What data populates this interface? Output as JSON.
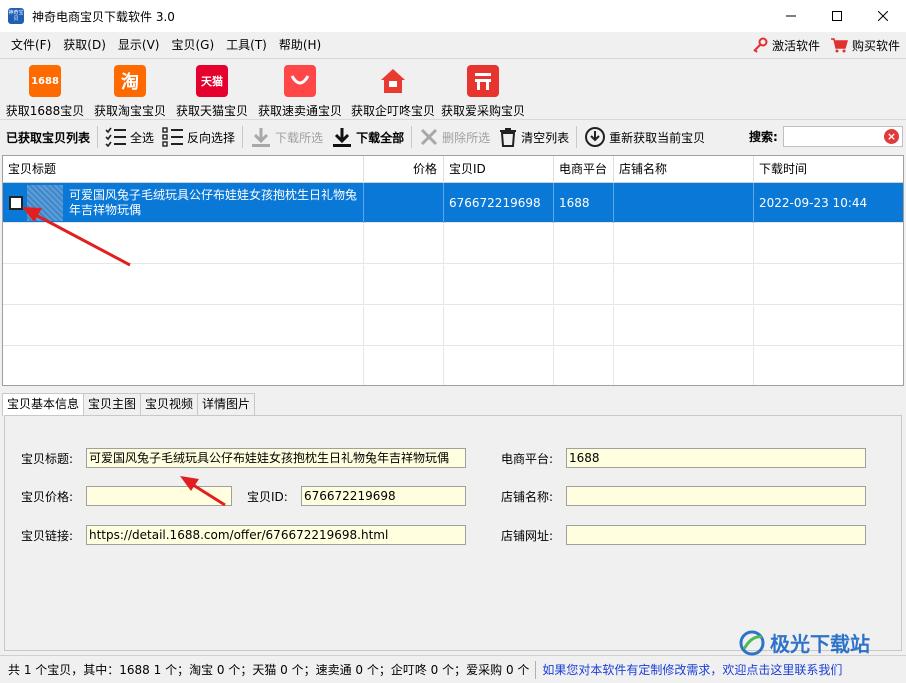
{
  "window": {
    "title": "神奇电商宝贝下载软件 3.0",
    "icon_text": "神奇宝贝",
    "controls": [
      "minimize-icon",
      "maximize-icon",
      "close-icon"
    ]
  },
  "menu": {
    "items": [
      "文件(F)",
      "获取(D)",
      "显示(V)",
      "宝贝(G)",
      "工具(T)",
      "帮助(H)"
    ],
    "activate": "激活软件",
    "buy": "购买软件"
  },
  "big_toolbar": [
    {
      "label": "获取1688宝贝",
      "icon": "1688",
      "color": "#ff6a00"
    },
    {
      "label": "获取淘宝宝贝",
      "icon": "淘",
      "color": "#ff6a00"
    },
    {
      "label": "获取天猫宝贝",
      "icon": "天猫",
      "color": "#e5002d"
    },
    {
      "label": "获取速卖通宝贝",
      "icon": "aliexpress-icon",
      "color": "#ff4747"
    },
    {
      "label": "获取企叮咚宝贝",
      "icon": "house-icon",
      "color": "#e83a2e"
    },
    {
      "label": "获取爱采购宝贝",
      "icon": "aicaigou-icon",
      "color": "#e8342e"
    }
  ],
  "toolbar2": {
    "list_label": "已获取宝贝列表",
    "select_all": "全选",
    "invert": "反向选择",
    "download_selected": "下载所选",
    "download_all": "下载全部",
    "delete_selected": "删除所选",
    "clear_list": "清空列表",
    "refetch": "重新获取当前宝贝",
    "search_label": "搜索:",
    "search_value": ""
  },
  "grid": {
    "columns": [
      "宝贝标题",
      "价格",
      "宝贝ID",
      "电商平台",
      "店铺名称",
      "下载时间"
    ],
    "rows": [
      {
        "title": "可爱国风兔子毛绒玩具公仔布娃娃女孩抱枕生日礼物兔年吉祥物玩偶",
        "price": "",
        "id": "676672219698",
        "platform": "1688",
        "shop": "",
        "time": "2022-09-23 10:44",
        "selected": true,
        "checked": false
      }
    ]
  },
  "tabs": [
    "宝贝基本信息",
    "宝贝主图",
    "宝贝视频",
    "详情图片"
  ],
  "detail": {
    "title_label": "宝贝标题:",
    "title_value": "可爱国风兔子毛绒玩具公仔布娃娃女孩抱枕生日礼物兔年吉祥物玩偶",
    "platform_label": "电商平台:",
    "platform_value": "1688",
    "price_label": "宝贝价格:",
    "price_value": "",
    "id_label": "宝贝ID:",
    "id_value": "676672219698",
    "shop_label": "店铺名称:",
    "shop_value": "",
    "link_label": "宝贝链接:",
    "link_value": "https://detail.1688.com/offer/676672219698.html",
    "shop_url_label": "店铺网址:",
    "shop_url_value": ""
  },
  "status": {
    "summary": "共 1 个宝贝，其中：1688 1 个；淘宝 0 个；天猫 0 个；速卖通 0 个；企叮咚 0 个；爱采购 0 个",
    "link": "如果您对本软件有定制修改需求，欢迎点击这里联系我们"
  },
  "watermark": "极光下载站"
}
